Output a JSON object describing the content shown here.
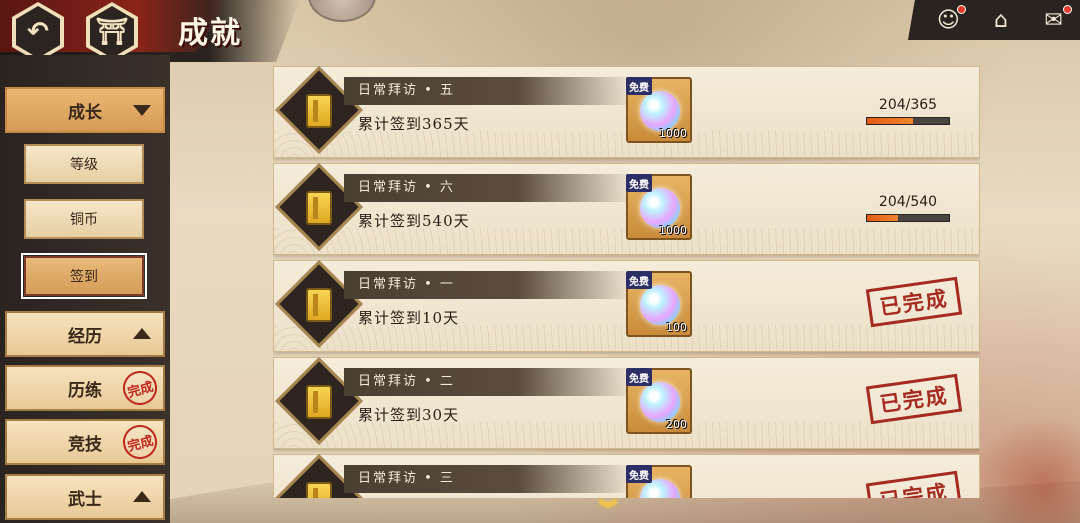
{
  "header": {
    "title": "成就",
    "back_icon": "back-arrow-icon",
    "home_icon": "castle-home-icon"
  },
  "topright": {
    "icons": [
      "character-icon",
      "upgrade-home-icon",
      "mail-icon"
    ],
    "glyphs": [
      "☺",
      "⌂",
      "✉"
    ]
  },
  "sidebar": {
    "main": [
      {
        "label": "成长",
        "state": "expanded"
      },
      {
        "label": "经历",
        "state": "collapsed"
      },
      {
        "label": "历练",
        "state": "complete"
      },
      {
        "label": "竞技",
        "state": "complete"
      },
      {
        "label": "武士",
        "state": "collapsed"
      }
    ],
    "sub": [
      {
        "label": "等级"
      },
      {
        "label": "铜币"
      },
      {
        "label": "签到",
        "selected": true
      }
    ],
    "stamp_text": "完成"
  },
  "achievements": [
    {
      "title": "日常拜访 • 五",
      "desc": "累计签到365天",
      "reward_tag": "免费",
      "reward_count": "1000",
      "progress_text": "204/365",
      "progress": 0.559
    },
    {
      "title": "日常拜访 • 六",
      "desc": "累计签到540天",
      "reward_tag": "免费",
      "reward_count": "1000",
      "progress_text": "204/540",
      "progress": 0.378
    },
    {
      "title": "日常拜访 • 一",
      "desc": "累计签到10天",
      "reward_tag": "免费",
      "reward_count": "100",
      "status": "已完成"
    },
    {
      "title": "日常拜访 • 二",
      "desc": "累计签到30天",
      "reward_tag": "免费",
      "reward_count": "200",
      "status": "已完成"
    },
    {
      "title": "日常拜访 • 三",
      "desc": "",
      "reward_tag": "免费",
      "reward_count": "",
      "status": "已完成"
    }
  ],
  "scroll_hint": "︾"
}
